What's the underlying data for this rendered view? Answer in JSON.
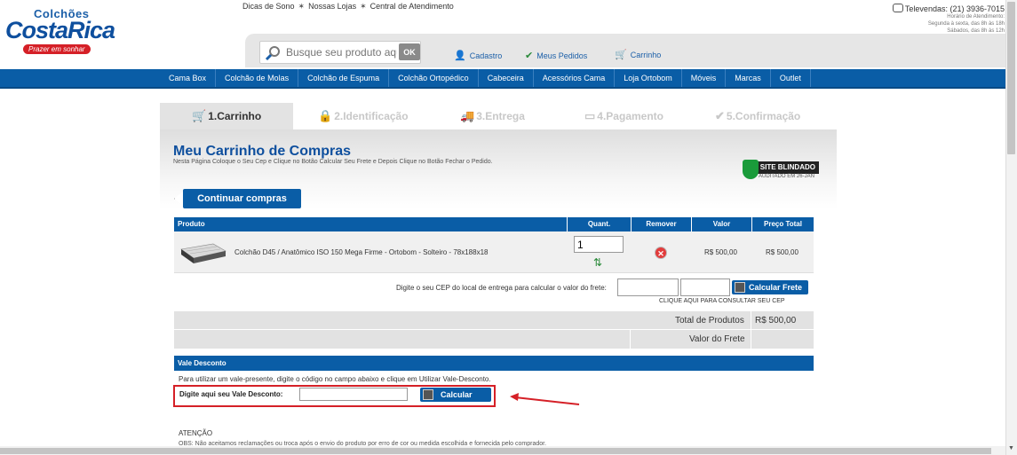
{
  "brand": {
    "logo_top": "Colchões",
    "logo_main": "CostaRica",
    "logo_slogan": "Prazer em sonhar"
  },
  "top_links": [
    "Dicas de Sono",
    "Nossas Lojas",
    "Central de Atendimento"
  ],
  "top_links_sep": "✶",
  "televendas": {
    "phone": "Televendas: (21) 3936-7015",
    "hours": [
      "Horário de Atendimento:",
      "Segunda à sexta, das 8h às 18h",
      "Sábados, das 8h às 12h"
    ]
  },
  "search": {
    "placeholder": "Busque seu produto aqui",
    "ok_label": "OK"
  },
  "account_links": {
    "cadastro": "Cadastro",
    "pedidos": "Meus Pedidos",
    "carrinho": "Carrinho"
  },
  "nav": [
    "Cama Box",
    "Colchão de Molas",
    "Colchão de Espuma",
    "Colchão Ortopédico",
    "Cabeceira",
    "Acessórios Cama",
    "Loja Ortobom",
    "Móveis",
    "Marcas",
    "Outlet"
  ],
  "steps": [
    "1.Carrinho",
    "2.Identificação",
    "3.Entrega",
    "4.Pagamento",
    "5.Confirmação"
  ],
  "cart": {
    "title": "Meu Carrinho de Compras",
    "subtitle": "Nesta Página Coloque o Seu Cep e Clique no Botão Calcular Seu Frete e Depois Clique no Botão Fechar o Pedido.",
    "seal_label": "SITE BLINDADO",
    "seal_sub": "AUDITADO EM 26-JAN",
    "continue_label": "Continuar compras",
    "columns": [
      "Produto",
      "Quant.",
      "Remover",
      "Valor",
      "Preço Total"
    ],
    "items": [
      {
        "name": "Colchão D45 / Anatômico ISO 150 Mega Firme - Ortobom - Solteiro - 78x188x18",
        "quantity": "1",
        "value": "R$ 500,00",
        "total": "R$ 500,00"
      }
    ],
    "cep_label": "Digite o seu CEP do local de entrega para calcular o valor do frete:",
    "calc_frete_label": "Calcular Frete",
    "cep_link": "CLIQUE AQUI PARA CONSULTAR SEU CEP",
    "total_products_label": "Total de Produtos",
    "total_products_value": "R$ 500,00",
    "freight_label": "Valor do Frete"
  },
  "voucher": {
    "header": "Vale Desconto",
    "instructions": "Para utilizar um vale-presente, digite o código no campo abaixo e clique em Utilizar Vale-Desconto.",
    "label": "Digite aqui seu Vale Desconto:",
    "button_label": "Calcular"
  },
  "notice": {
    "title": "ATENÇÃO",
    "obs": "OBS: Não aceitamos reclamações ou troca após o envio do produto por erro de cor ou medida escolhida e fornecida pelo comprador."
  },
  "colors": {
    "primary_blue": "#0a5da6",
    "highlight_red": "#d52027"
  }
}
